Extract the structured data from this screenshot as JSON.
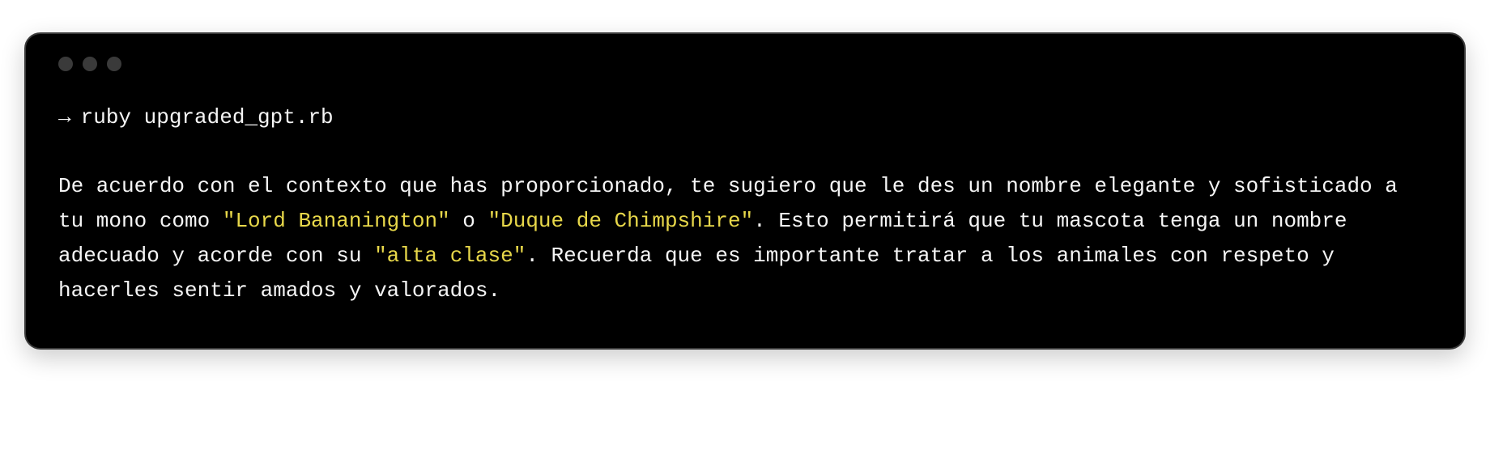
{
  "terminal": {
    "prompt_arrow": "→",
    "command": "ruby upgraded_gpt.rb",
    "output": {
      "text_1": "De acuerdo con el contexto que has proporcionado, te sugiero que le des un nombre elegante y sofisticado a tu mono como ",
      "highlight_1": "\"Lord Bananington\"",
      "text_2": " o ",
      "highlight_2": "\"Duque de Chimpshire\"",
      "text_3": ". Esto permitirá que tu mascota tenga un nombre adecuado y acorde con su ",
      "highlight_3": "\"alta clase\"",
      "text_4": ". Recuerda que es importante tratar a los animales con respeto y hacerles sentir amados y valorados."
    }
  }
}
